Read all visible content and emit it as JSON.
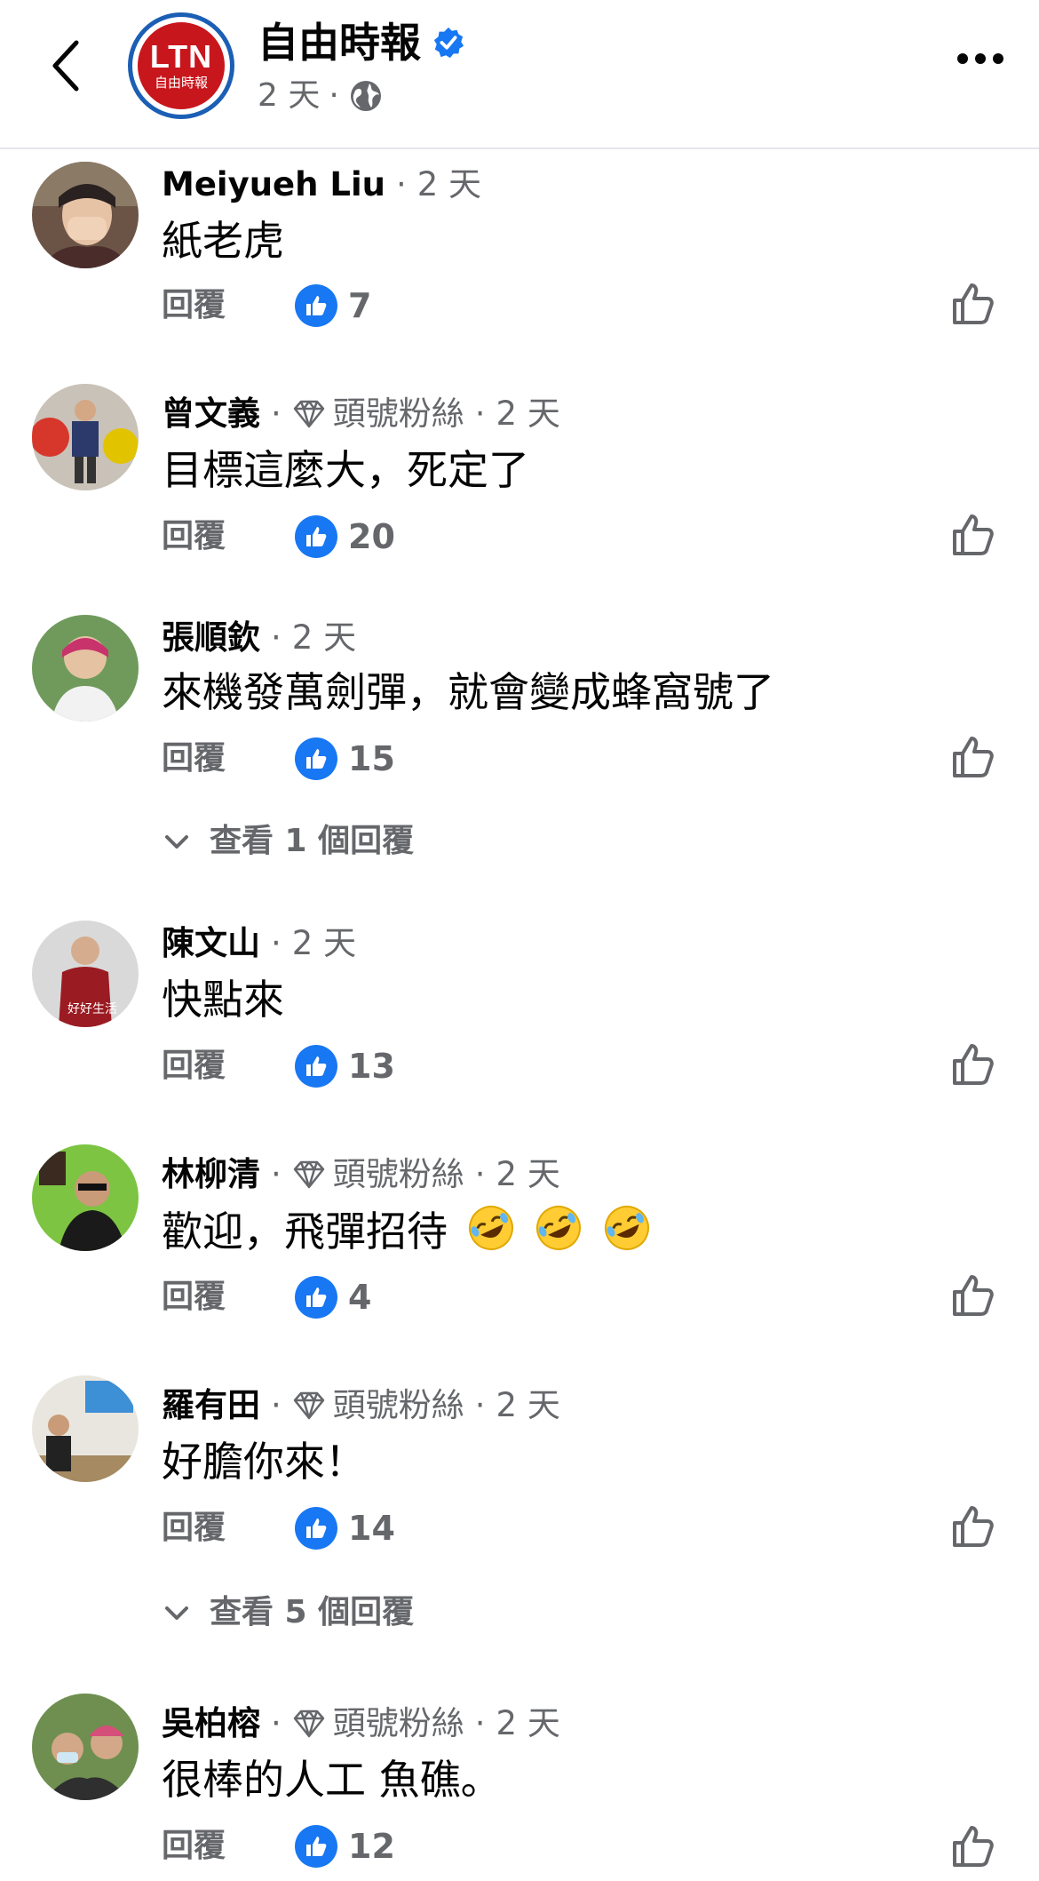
{
  "header": {
    "page_name": "自由時報",
    "logo_text": "LTN",
    "logo_subtext": "自由時報",
    "time": "2 天",
    "separator": "·",
    "back_icon": "chevron-left-icon",
    "more_icon": "more-horizontal-icon",
    "verified_color": "#1877f2",
    "logo_color": "#c8161d"
  },
  "ui": {
    "reply_label": "回覆",
    "dot": "·",
    "top_fan_label": "頭號粉絲",
    "like_color": "#1877f2"
  },
  "comments": [
    {
      "author": "Meiyueh Liu",
      "time": "2 天",
      "top_fan": false,
      "text": "紙老虎",
      "likes": "7"
    },
    {
      "author": "曾文義",
      "time": "2 天",
      "top_fan": true,
      "text": "目標這麼大，死定了",
      "likes": "20"
    },
    {
      "author": "張順欽",
      "time": "2 天",
      "top_fan": false,
      "text": "來機發萬劍彈，就會變成蜂窩號了",
      "likes": "15",
      "view_replies": "查看 1 個回覆"
    },
    {
      "author": "陳文山",
      "time": "2 天",
      "top_fan": false,
      "text": "快點來",
      "likes": "13"
    },
    {
      "author": "林柳清",
      "time": "2 天",
      "top_fan": true,
      "text": "歡迎，飛彈招待",
      "emoji": [
        "rolling-laughing-emoji",
        "rolling-laughing-emoji",
        "rolling-laughing-emoji"
      ],
      "likes": "4"
    },
    {
      "author": "羅有田",
      "time": "2 天",
      "top_fan": true,
      "text": "好膽你來！",
      "likes": "14",
      "view_replies": "查看 5 個回覆"
    },
    {
      "author": "吳柏榕",
      "time": "2 天",
      "top_fan": true,
      "text": "很棒的人工 魚礁。",
      "likes": "12"
    }
  ]
}
